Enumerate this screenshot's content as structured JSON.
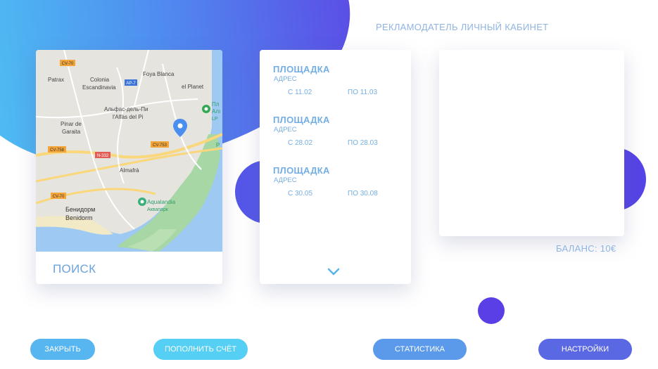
{
  "header": {
    "title": "РЕКЛАМОДАТЕЛЬ ЛИЧНЫЙ КАБИНЕТ"
  },
  "map": {
    "labels": {
      "patrax": "Patrax",
      "colonia": "Colonia",
      "escandinavia": "Escandinavia",
      "foya_blanca": "Foya Blanca",
      "el_planet": "el Planet",
      "alfas_ru": "Альфас-дель-Пи",
      "alfas": "l'Alfàs del Pi",
      "pinar": "Pinar de",
      "garaita": "Garaita",
      "almafra": "Almafrà",
      "aqualandia": "Aqualandia",
      "aquapark_ru": "Аквапарк",
      "benidorm_ru": "Бенидорм",
      "benidorm": "Benidorm",
      "pl_1": "Пл",
      "pl_2": "Алı",
      "pl_3": "LP",
      "p_side": "P"
    },
    "roads": {
      "cv70a": "CV-70",
      "ap7": "AP-7",
      "cv758": "CV-758",
      "n332": "N-332",
      "cv753": "CV-753",
      "cv70b": "CV-70"
    },
    "search_label": "ПОИСК"
  },
  "venues": [
    {
      "name": "ПЛОЩАДКА",
      "address": "АДРЕС",
      "from": "С 11.02",
      "to": "ПО 11.03"
    },
    {
      "name": "ПЛОЩАДКА",
      "address": "АДРЕС",
      "from": "С 28.02",
      "to": "ПО 28.03"
    },
    {
      "name": "ПЛОЩАДКА",
      "address": "АДРЕС",
      "from": "С 30.05",
      "to": "ПО 30.08"
    }
  ],
  "balance": "БАЛАНС: 10€",
  "buttons": {
    "close": "ЗАКРЫТЬ",
    "topup": "ПОПОЛНИТЬ СЧЁТ",
    "stats": "СТАТИСТИКА",
    "settings": "НАСТРОЙКИ"
  },
  "colors": {
    "accent": "#5b4fe6",
    "text": "#74aee4",
    "gradient_start": "#4ec3f3",
    "gradient_end": "#5b4fe6"
  }
}
